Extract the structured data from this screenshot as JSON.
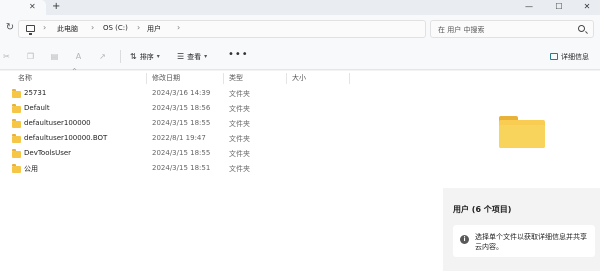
{
  "tabs": {
    "new_tab": "+"
  },
  "window": {
    "minimize": "—",
    "maximize": "☐"
  },
  "breadcrumb": [
    "此电脑",
    "OS (C:)",
    "用户"
  ],
  "search": {
    "placeholder": "在 用户 中搜索"
  },
  "toolbar": {
    "sort_label": "排序",
    "view_label": "查看",
    "more_label": "•••",
    "details_label": "详细信息"
  },
  "columns": {
    "name": "名称",
    "modified": "修改日期",
    "type": "类型",
    "size": "大小"
  },
  "files": [
    {
      "name": "25731",
      "modified": "2024/3/16 14:39",
      "type": "文件夹"
    },
    {
      "name": "Default",
      "modified": "2024/3/15 18:56",
      "type": "文件夹"
    },
    {
      "name": "defaultuser100000",
      "modified": "2024/3/15 18:55",
      "type": "文件夹"
    },
    {
      "name": "defaultuser100000.BOT",
      "modified": "2022/8/1 19:47",
      "type": "文件夹"
    },
    {
      "name": "DevToolsUser",
      "modified": "2024/3/15 18:55",
      "type": "文件夹"
    },
    {
      "name": "公用",
      "modified": "2024/3/15 18:51",
      "type": "文件夹"
    }
  ],
  "details": {
    "title": "用户 (6 个项目)",
    "info": "选择单个文件以获取详细信息并共享云内容。"
  },
  "colors": {
    "folder": "#f6c746",
    "accent": "#2b7a8c"
  }
}
